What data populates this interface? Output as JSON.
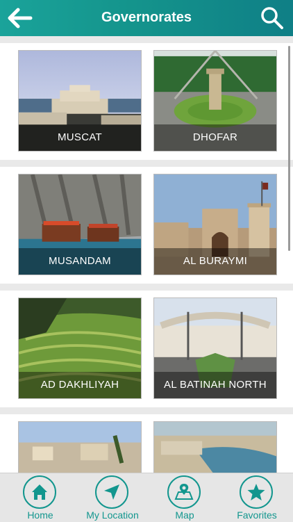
{
  "header": {
    "title": "Governorates"
  },
  "governorates": [
    {
      "name": "MUSCAT"
    },
    {
      "name": "DHOFAR"
    },
    {
      "name": "MUSANDAM"
    },
    {
      "name": "AL BURAYMI"
    },
    {
      "name": "AD DAKHLIYAH"
    },
    {
      "name": "AL BATINAH NORTH"
    }
  ],
  "tabs": [
    {
      "label": "Home",
      "icon": "home-icon"
    },
    {
      "label": "My Location",
      "icon": "location-arrow-icon"
    },
    {
      "label": "Map",
      "icon": "map-pin-icon"
    },
    {
      "label": "Favorites",
      "icon": "star-icon"
    }
  ],
  "colors": {
    "accent": "#12968e",
    "header": "#14948c"
  }
}
